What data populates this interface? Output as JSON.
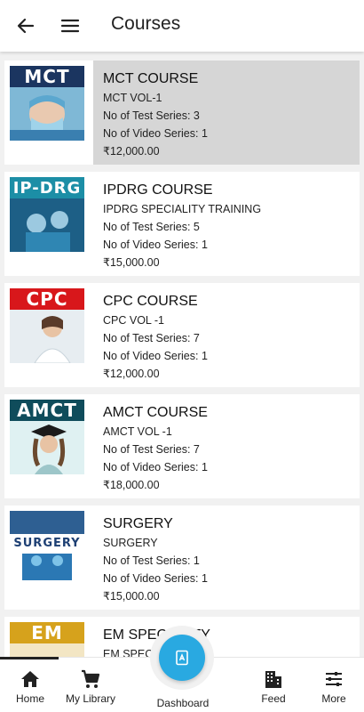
{
  "header": {
    "title": "Courses",
    "back_icon": "arrow-left-icon",
    "menu_icon": "hamburger-menu-icon"
  },
  "courses": [
    {
      "badge": "MCT",
      "badge_color": "#1b3560",
      "name": "MCT COURSE",
      "subtitle": "MCT VOL-1",
      "tests": "No of Test Series: 3",
      "videos": "No of Video Series: 1",
      "price": "₹12,000.00",
      "selected": true
    },
    {
      "badge": "IP-DRG",
      "badge_color": "#1c8ea6",
      "name": "IPDRG COURSE",
      "subtitle": "IPDRG SPECIALITY TRAINING",
      "tests": "No of Test Series: 5",
      "videos": "No of Video Series: 1",
      "price": "₹15,000.00",
      "selected": false
    },
    {
      "badge": "CPC",
      "badge_color": "#d8171b",
      "name": "CPC COURSE",
      "subtitle": "CPC VOL -1",
      "tests": "No of Test Series: 7",
      "videos": "No of Video Series: 1",
      "price": "₹12,000.00",
      "selected": false
    },
    {
      "badge": "AMCT",
      "badge_color": "#0f4c5b",
      "name": "AMCT COURSE",
      "subtitle": "AMCT VOL -1",
      "tests": "No of Test Series: 7",
      "videos": "No of Video Series: 1",
      "price": "₹18,000.00",
      "selected": false
    },
    {
      "badge": "SURGERY",
      "badge_color": "#1d4d8a",
      "name": "SURGERY",
      "subtitle": "SURGERY",
      "tests": "No of Test Series: 1",
      "videos": "No of Video Series: 1",
      "price": "₹15,000.00",
      "selected": false
    },
    {
      "badge": "EM",
      "badge_color": "#d6a21c",
      "name": "EM SPECIALITY",
      "subtitle": "EM SPECIALITY",
      "tests": "",
      "videos": "",
      "price": "",
      "selected": false
    }
  ],
  "bottom_nav": {
    "home": {
      "label": "Home",
      "icon": "home-icon"
    },
    "library": {
      "label": "My Library",
      "icon": "cart-icon"
    },
    "dashboard": {
      "label": "Dashboard",
      "icon": "book-icon"
    },
    "feed": {
      "label": "Feed",
      "icon": "building-icon"
    },
    "more": {
      "label": "More",
      "icon": "sliders-icon"
    }
  },
  "colors": {
    "accent": "#29a9e1",
    "selected_bg": "#d6d6d6"
  }
}
